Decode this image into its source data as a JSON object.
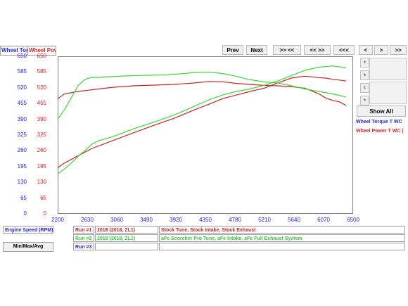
{
  "header": {
    "torque_label": "Wheel Torque",
    "power_label": "Wheel Power"
  },
  "toolbar": {
    "prev": "Prev",
    "next": "Next",
    "btn3": ">> <<",
    "btn4": "<< >>",
    "btn5": "<<<",
    "btn6": "<",
    "btn7": ">",
    "btn8": ">>"
  },
  "side": {
    "show_all": "Show All",
    "legend_torque": "Wheel Torque T WC",
    "legend_power": "Wheel Power T WC (",
    "small_btn": "±"
  },
  "footer": {
    "x_label": "Engine Speed (RPM)",
    "minmax": "Min/Max/Avg",
    "runs": [
      {
        "run": "Run #1",
        "vehicle": "2018 (2018, ZL1)",
        "desc": "Stock Tune, Stock Intake, Stock Exhaust"
      },
      {
        "run": "Run #2",
        "vehicle": "2018 (2018, ZL1)",
        "desc": "aFe Scorcher Pro Tune, aFe Intake, aFe Full Exhaust System"
      },
      {
        "run": "Run #3",
        "vehicle": "",
        "desc": ""
      }
    ]
  },
  "colors": {
    "run1": "#cc2222",
    "run2": "#33dd33",
    "axis_blue": "#2222ee",
    "axis_red": "#dd2222"
  },
  "chart_data": {
    "type": "line",
    "xlabel": "Engine Speed (RPM)",
    "xlim": [
      2200,
      6500
    ],
    "x_ticks": [
      2200,
      2630,
      3060,
      3490,
      3920,
      4350,
      4780,
      5210,
      5640,
      6070,
      6500
    ],
    "y_left_ticks": [
      0,
      65,
      130,
      195,
      260,
      325,
      390,
      455,
      520,
      585,
      650
    ],
    "y_right_ticks": [
      0,
      65,
      130,
      195,
      260,
      325,
      390,
      455,
      520,
      585,
      650
    ],
    "ylim": [
      0,
      650
    ],
    "grid": false,
    "series": [
      {
        "name": "Run #1 Wheel Torque",
        "color": "#cc2222",
        "x": [
          2200,
          2300,
          2500,
          2700,
          3000,
          3300,
          3600,
          3900,
          4200,
          4400,
          4600,
          4800,
          5000,
          5200,
          5400,
          5600,
          5800,
          6000,
          6100,
          6200,
          6300,
          6400
        ],
        "y": [
          475,
          495,
          505,
          512,
          522,
          528,
          531,
          534,
          540,
          546,
          545,
          538,
          534,
          530,
          528,
          525,
          518,
          495,
          478,
          468,
          462,
          447
        ]
      },
      {
        "name": "Run #1 Wheel Power",
        "color": "#cc2222",
        "x": [
          2200,
          2300,
          2500,
          2700,
          3000,
          3300,
          3600,
          3900,
          4200,
          4400,
          4600,
          4800,
          5000,
          5200,
          5400,
          5600,
          5800,
          6000,
          6100,
          6200,
          6300,
          6400
        ],
        "y": [
          190,
          210,
          240,
          270,
          302,
          334,
          365,
          395,
          430,
          452,
          475,
          490,
          505,
          518,
          540,
          560,
          568,
          562,
          560,
          555,
          552,
          548
        ]
      },
      {
        "name": "Run #2 Wheel Torque",
        "color": "#33dd33",
        "x": [
          2200,
          2300,
          2400,
          2500,
          2600,
          2700,
          2800,
          3000,
          3200,
          3400,
          3600,
          3800,
          4000,
          4200,
          4400,
          4600,
          4800,
          5000,
          5200,
          5400,
          5600,
          5800,
          6000,
          6200,
          6400
        ],
        "y": [
          390,
          430,
          480,
          530,
          555,
          563,
          563,
          566,
          569,
          571,
          572,
          574,
          578,
          583,
          584,
          579,
          567,
          553,
          545,
          540,
          528,
          515,
          505,
          495,
          482
        ]
      },
      {
        "name": "Run #2 Wheel Power",
        "color": "#33dd33",
        "x": [
          2200,
          2300,
          2400,
          2500,
          2600,
          2700,
          2800,
          3000,
          3200,
          3400,
          3600,
          3800,
          4000,
          4200,
          4400,
          4600,
          4800,
          5000,
          5200,
          5400,
          5600,
          5800,
          6000,
          6200,
          6400
        ],
        "y": [
          165,
          185,
          210,
          238,
          262,
          288,
          302,
          318,
          340,
          360,
          378,
          398,
          420,
          445,
          470,
          490,
          505,
          515,
          530,
          548,
          570,
          592,
          605,
          610,
          602
        ]
      }
    ]
  }
}
